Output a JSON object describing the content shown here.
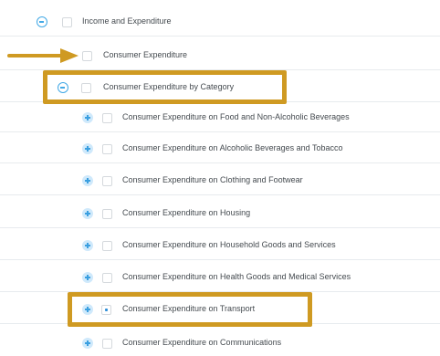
{
  "tree": {
    "items": [
      {
        "label": "Income and Expenditure",
        "toggle": "collapse",
        "checked": false
      },
      {
        "label": "Consumer Expenditure",
        "toggle": "none",
        "checked": false
      },
      {
        "label": "Consumer Expenditure by Category",
        "toggle": "collapse",
        "checked": false
      },
      {
        "label": "Consumer Expenditure on Food and Non-Alcoholic Beverages",
        "toggle": "expand",
        "checked": false
      },
      {
        "label": "Consumer Expenditure on Alcoholic Beverages and Tobacco",
        "toggle": "expand",
        "checked": false
      },
      {
        "label": "Consumer Expenditure on Clothing and Footwear",
        "toggle": "expand",
        "checked": false
      },
      {
        "label": "Consumer Expenditure on Housing",
        "toggle": "expand",
        "checked": false
      },
      {
        "label": "Consumer Expenditure on Household Goods and Services",
        "toggle": "expand",
        "checked": false
      },
      {
        "label": "Consumer Expenditure on Health Goods and Medical Services",
        "toggle": "expand",
        "checked": false
      },
      {
        "label": "Consumer Expenditure on Transport",
        "toggle": "expand",
        "checked": true
      },
      {
        "label": "Consumer Expenditure on Communications",
        "toggle": "expand",
        "checked": false
      }
    ]
  },
  "colors": {
    "highlight": "#cf9a22",
    "toggle_blue": "#42a9e6",
    "divider": "#e7ebee"
  }
}
